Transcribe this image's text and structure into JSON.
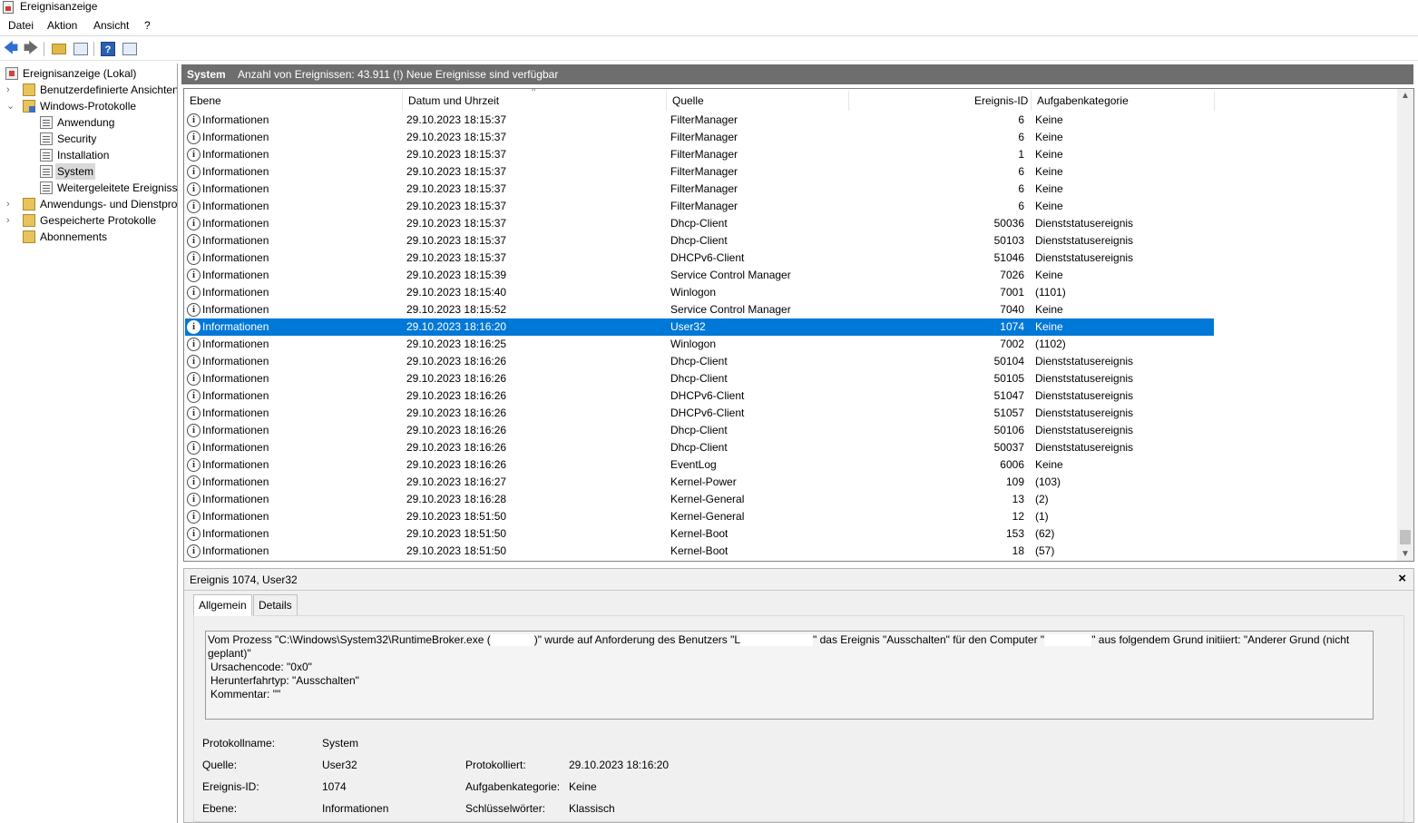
{
  "window": {
    "title": "Ereignisanzeige",
    "icon": "event-viewer-icon"
  },
  "menu": [
    "Datei",
    "Aktion",
    "Ansicht",
    "?"
  ],
  "toolbar": {
    "buttons": [
      "back-icon",
      "forward-icon",
      "up-folder-icon",
      "console-tree-icon",
      "help-icon",
      "action-pane-icon"
    ]
  },
  "tree": {
    "items": [
      {
        "label": "Ereignisanzeige (Lokal)",
        "icon": "event-viewer-icon"
      },
      {
        "label": "Benutzerdefinierte Ansichten",
        "icon": "folder-icon"
      },
      {
        "label": "Windows-Protokolle",
        "icon": "folder-icon"
      },
      {
        "label": "Anwendung",
        "icon": "log-icon"
      },
      {
        "label": "Security",
        "icon": "log-icon"
      },
      {
        "label": "Installation",
        "icon": "log-icon"
      },
      {
        "label": "System",
        "icon": "log-icon"
      },
      {
        "label": "Weitergeleitete Ereignisse",
        "icon": "log-icon"
      },
      {
        "label": "Anwendungs- und Dienstprotokolle",
        "icon": "folder-icon"
      },
      {
        "label": "Gespeicherte Protokolle",
        "icon": "folder-icon"
      },
      {
        "label": "Abonnements",
        "icon": "subscription-icon"
      }
    ]
  },
  "log_header": {
    "title": "System",
    "info": "Anzahl von Ereignissen: 43.911 (!) Neue Ereignisse sind verfügbar"
  },
  "columns": [
    "Ebene",
    "Datum und Uhrzeit",
    "Quelle",
    "Ereignis-ID",
    "Aufgabenkategorie"
  ],
  "events": [
    {
      "level": "Informationen",
      "datetime": "29.10.2023 18:15:37",
      "source": "FilterManager",
      "id": "6",
      "category": "Keine"
    },
    {
      "level": "Informationen",
      "datetime": "29.10.2023 18:15:37",
      "source": "FilterManager",
      "id": "6",
      "category": "Keine"
    },
    {
      "level": "Informationen",
      "datetime": "29.10.2023 18:15:37",
      "source": "FilterManager",
      "id": "1",
      "category": "Keine"
    },
    {
      "level": "Informationen",
      "datetime": "29.10.2023 18:15:37",
      "source": "FilterManager",
      "id": "6",
      "category": "Keine"
    },
    {
      "level": "Informationen",
      "datetime": "29.10.2023 18:15:37",
      "source": "FilterManager",
      "id": "6",
      "category": "Keine"
    },
    {
      "level": "Informationen",
      "datetime": "29.10.2023 18:15:37",
      "source": "FilterManager",
      "id": "6",
      "category": "Keine"
    },
    {
      "level": "Informationen",
      "datetime": "29.10.2023 18:15:37",
      "source": "Dhcp-Client",
      "id": "50036",
      "category": "Dienststatusereignis"
    },
    {
      "level": "Informationen",
      "datetime": "29.10.2023 18:15:37",
      "source": "Dhcp-Client",
      "id": "50103",
      "category": "Dienststatusereignis"
    },
    {
      "level": "Informationen",
      "datetime": "29.10.2023 18:15:37",
      "source": "DHCPv6-Client",
      "id": "51046",
      "category": "Dienststatusereignis"
    },
    {
      "level": "Informationen",
      "datetime": "29.10.2023 18:15:39",
      "source": "Service Control Manager",
      "id": "7026",
      "category": "Keine"
    },
    {
      "level": "Informationen",
      "datetime": "29.10.2023 18:15:40",
      "source": "Winlogon",
      "id": "7001",
      "category": "(1101)"
    },
    {
      "level": "Informationen",
      "datetime": "29.10.2023 18:15:52",
      "source": "Service Control Manager",
      "id": "7040",
      "category": "Keine"
    },
    {
      "level": "Informationen",
      "datetime": "29.10.2023 18:16:20",
      "source": "User32",
      "id": "1074",
      "category": "Keine",
      "selected": true
    },
    {
      "level": "Informationen",
      "datetime": "29.10.2023 18:16:25",
      "source": "Winlogon",
      "id": "7002",
      "category": "(1102)"
    },
    {
      "level": "Informationen",
      "datetime": "29.10.2023 18:16:26",
      "source": "Dhcp-Client",
      "id": "50104",
      "category": "Dienststatusereignis"
    },
    {
      "level": "Informationen",
      "datetime": "29.10.2023 18:16:26",
      "source": "Dhcp-Client",
      "id": "50105",
      "category": "Dienststatusereignis"
    },
    {
      "level": "Informationen",
      "datetime": "29.10.2023 18:16:26",
      "source": "DHCPv6-Client",
      "id": "51047",
      "category": "Dienststatusereignis"
    },
    {
      "level": "Informationen",
      "datetime": "29.10.2023 18:16:26",
      "source": "DHCPv6-Client",
      "id": "51057",
      "category": "Dienststatusereignis"
    },
    {
      "level": "Informationen",
      "datetime": "29.10.2023 18:16:26",
      "source": "Dhcp-Client",
      "id": "50106",
      "category": "Dienststatusereignis"
    },
    {
      "level": "Informationen",
      "datetime": "29.10.2023 18:16:26",
      "source": "Dhcp-Client",
      "id": "50037",
      "category": "Dienststatusereignis"
    },
    {
      "level": "Informationen",
      "datetime": "29.10.2023 18:16:26",
      "source": "EventLog",
      "id": "6006",
      "category": "Keine"
    },
    {
      "level": "Informationen",
      "datetime": "29.10.2023 18:16:27",
      "source": "Kernel-Power",
      "id": "109",
      "category": "(103)"
    },
    {
      "level": "Informationen",
      "datetime": "29.10.2023 18:16:28",
      "source": "Kernel-General",
      "id": "13",
      "category": "(2)"
    },
    {
      "level": "Informationen",
      "datetime": "29.10.2023 18:51:50",
      "source": "Kernel-General",
      "id": "12",
      "category": "(1)"
    },
    {
      "level": "Informationen",
      "datetime": "29.10.2023 18:51:50",
      "source": "Kernel-Boot",
      "id": "153",
      "category": "(62)"
    },
    {
      "level": "Informationen",
      "datetime": "29.10.2023 18:51:50",
      "source": "Kernel-Boot",
      "id": "18",
      "category": "(57)"
    }
  ],
  "detail": {
    "title": "Ereignis 1074, User32",
    "close": "×",
    "tabs": [
      "Allgemein",
      "Details"
    ],
    "message": {
      "part1": "Vom Prozess \"C:\\Windows\\System32\\RuntimeBroker.exe (",
      "part2": ")\" wurde auf Anforderung des Benutzers \"L",
      "part3": "\" das Ereignis \"Ausschalten\" für den Computer \"",
      "part4": "\" aus folgendem Grund initiiert: \"Anderer Grund (nicht geplant)\"",
      "line2": "Ursachencode: \"0x0\"",
      "line3": "Herunterfahrtyp: \"Ausschalten\"",
      "line4": "Kommentar: \"\""
    },
    "props": {
      "protokollname_label": "Protokollname:",
      "protokollname": "System",
      "quelle_label": "Quelle:",
      "quelle": "User32",
      "protokolliert_label": "Protokolliert:",
      "protokolliert": "29.10.2023 18:16:20",
      "id_label": "Ereignis-ID:",
      "id": "1074",
      "kategorie_label": "Aufgabenkategorie:",
      "kategorie": "Keine",
      "ebene_label": "Ebene:",
      "ebene": "Informationen",
      "keywords_label": "Schlüsselwörter:",
      "keywords": "Klassisch"
    }
  },
  "colors": {
    "selection": "#0078d7",
    "header_bar": "#6e6e6e"
  }
}
